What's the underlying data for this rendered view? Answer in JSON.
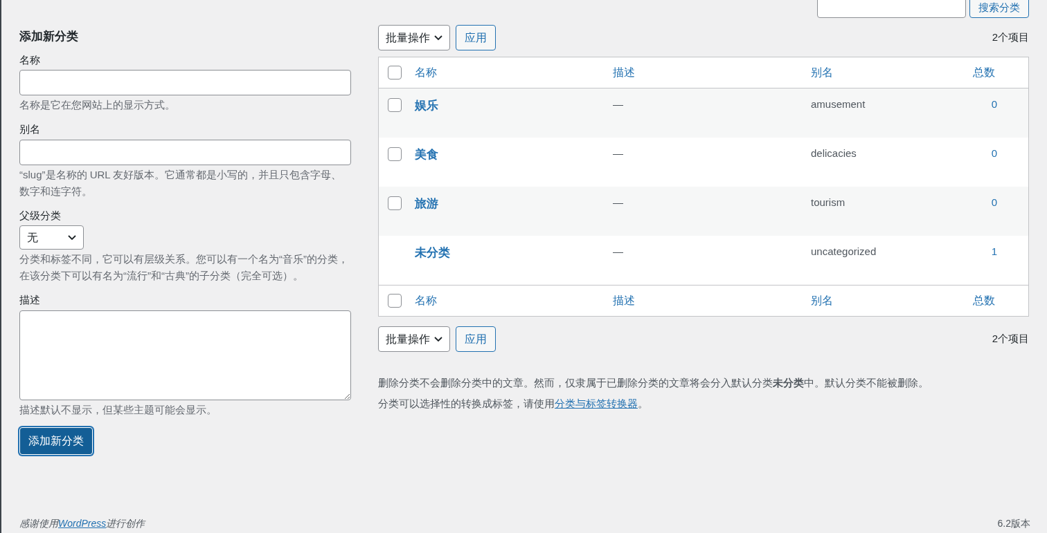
{
  "search": {
    "button": "搜索分类"
  },
  "form": {
    "title": "添加新分类",
    "fields": [
      {
        "kind": "text",
        "label": "名称",
        "help": "名称是它在您网站上的显示方式。"
      },
      {
        "kind": "text",
        "label": "别名",
        "help": "“slug”是名称的 URL 友好版本。它通常都是小写的，并且只包含字母、数字和连字符。"
      },
      {
        "kind": "select",
        "label": "父级分类",
        "value": "无",
        "help": "分类和标签不同，它可以有层级关系。您可以有一个名为“音乐”的分类，在该分类下可以有名为“流行”和“古典”的子分类（完全可选）。"
      },
      {
        "kind": "textarea",
        "label": "描述",
        "help": "描述默认不显示，但某些主题可能会显示。"
      }
    ],
    "submit": "添加新分类"
  },
  "bulk_top": {
    "action": "批量操作",
    "apply": "应用",
    "count": "2个项目"
  },
  "table": {
    "columns": [
      "名称",
      "描述",
      "别名",
      "总数"
    ],
    "header_checked": false,
    "rows": [
      {
        "name": "娱乐",
        "description": "—",
        "slug": "amusement",
        "count": "0",
        "has_checkbox": true,
        "checked": false
      },
      {
        "name": "美食",
        "description": "—",
        "slug": "delicacies",
        "count": "0",
        "has_checkbox": true,
        "checked": false
      },
      {
        "name": "旅游",
        "description": "—",
        "slug": "tourism",
        "count": "0",
        "has_checkbox": true,
        "checked": false
      },
      {
        "name": "未分类",
        "description": "—",
        "slug": "uncategorized",
        "count": "1",
        "has_checkbox": false
      }
    ],
    "footer_columns": [
      "名称",
      "描述",
      "别名",
      "总数"
    ],
    "footer_checked": false
  },
  "bulk_bottom": {
    "action": "批量操作",
    "apply": "应用",
    "count": "2个项目"
  },
  "notes": {
    "first": "删除分类不会删除分类中的文章。然而，仅隶属于已删除分类的文章将会分入默认分类**未分类**中。默认分类不能被删除。",
    "second_before": "分类可以选择性的转换成标签，请使用",
    "second_link": "分类与标签转换器",
    "second_after": "。"
  },
  "footer": {
    "thanks_before": "感谢使用",
    "thanks_link": "WordPress",
    "thanks_after": "进行创作",
    "version": "6.2版本"
  }
}
